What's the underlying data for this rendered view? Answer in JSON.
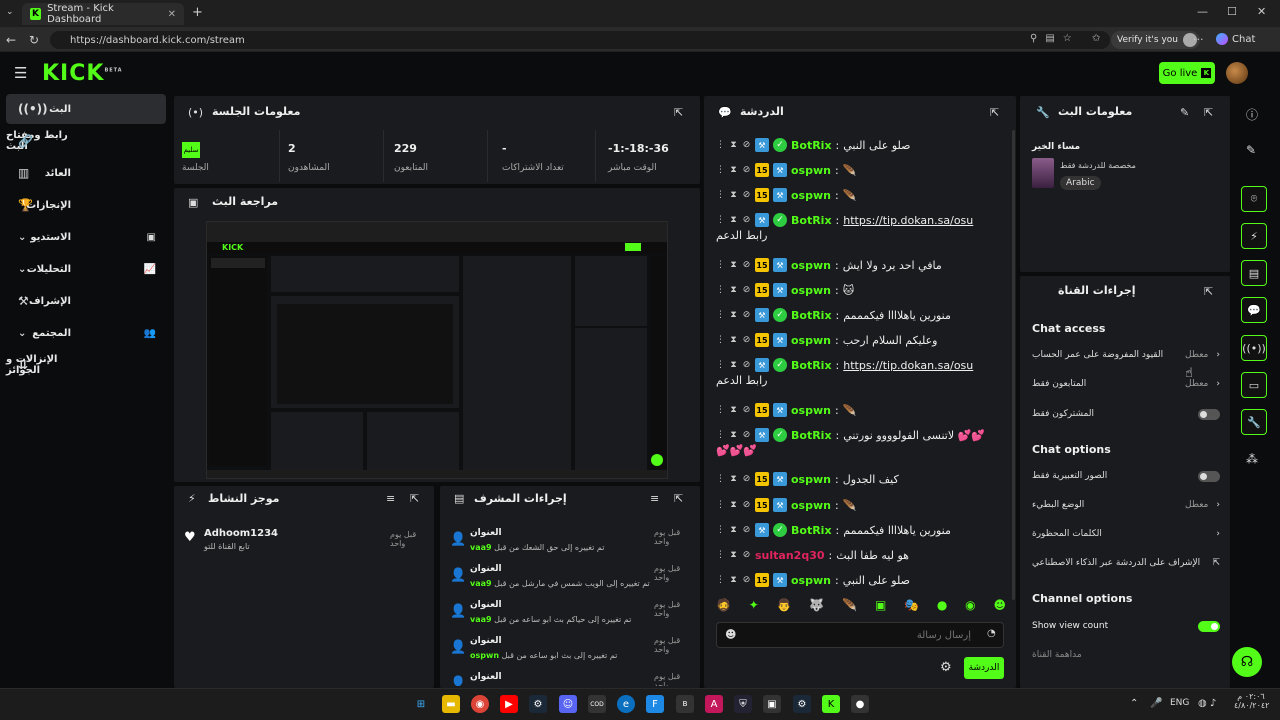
{
  "browser": {
    "tab_title": "Stream - Kick Dashboard",
    "url": "https://dashboard.kick.com/stream",
    "verify_label": "Verify it's you",
    "chat_label": "Chat"
  },
  "header": {
    "logo": "KICK",
    "logo_sup": "BETA",
    "go_live": "Go live"
  },
  "sidebar": {
    "items": [
      {
        "label": "البث"
      },
      {
        "label": "رابط ومفتاح البث"
      },
      {
        "label": "العائد"
      },
      {
        "label": "الإنجازات"
      },
      {
        "label": "الاستديو"
      },
      {
        "label": "التحليلات"
      },
      {
        "label": "الإشراف"
      },
      {
        "label": "المجتمع"
      },
      {
        "label": "الإنزالات و الجوائز"
      }
    ]
  },
  "session": {
    "title": "معلومات الجلسة",
    "badge": "سليم",
    "badge_caption": "الجلسة",
    "stats": [
      {
        "value": "2",
        "label": "المشاهدون"
      },
      {
        "value": "229",
        "label": "المتابعون"
      },
      {
        "value": "-",
        "label": "تعداد الاشتراكات"
      },
      {
        "value": "-1:-18:-36",
        "label": "الوقت مباشر"
      }
    ]
  },
  "preview": {
    "title": "مراجعة البث"
  },
  "activity": {
    "title": "موجز النشاط",
    "items": [
      {
        "user": "Adhoom1234",
        "desc": "تابع القناة للتو",
        "time": "قبل يوم واحد"
      }
    ]
  },
  "mod_actions": {
    "title": "إجراءات المشرف",
    "items": [
      {
        "title": "العنوان",
        "time": "قبل يوم واحد",
        "user": "vaa9",
        "desc": "تم تغييره إلى حق الشعك من قبل"
      },
      {
        "title": "العنوان",
        "time": "قبل يوم واحد",
        "user": "vaa9",
        "desc": "تم تغييره إلى الويب شمس في مارشل من قبل"
      },
      {
        "title": "العنوان",
        "time": "قبل يوم واحد",
        "user": "vaa9",
        "desc": "تم تغييره إلى حياكم بث ابو ساعه من قبل"
      },
      {
        "title": "العنوان",
        "time": "قبل يوم واحد",
        "user": "ospwn",
        "desc": "تم تغييره إلى بث ابو ساعه من قبل"
      },
      {
        "title": "العنوان",
        "time": "قبل يوم واحد",
        "user": "",
        "desc": ""
      }
    ]
  },
  "chat": {
    "title": "الدردشة",
    "placeholder": "إرسال رسالة",
    "send_label": "الدردشة",
    "messages": [
      {
        "user": "BotRix",
        "color": "#53fc18",
        "sub": "",
        "bot": true,
        "text": "صلو على النبي"
      },
      {
        "user": "ospwn",
        "color": "#53fc18",
        "sub": "15",
        "bot": false,
        "text": "🪶"
      },
      {
        "user": "ospwn",
        "color": "#53fc18",
        "sub": "15",
        "bot": false,
        "text": "🪶"
      },
      {
        "user": "BotRix",
        "color": "#53fc18",
        "sub": "",
        "bot": true,
        "text": "https://tip.dokan.sa/osu",
        "cont": "رابط الدعم"
      },
      {
        "user": "ospwn",
        "color": "#53fc18",
        "sub": "15",
        "bot": false,
        "text": "مافي احد يرد ولا ايش"
      },
      {
        "user": "ospwn",
        "color": "#53fc18",
        "sub": "15",
        "bot": false,
        "text": "🐱"
      },
      {
        "user": "BotRix",
        "color": "#53fc18",
        "sub": "",
        "bot": true,
        "text": "منورين ياهلاااا فيكمممم"
      },
      {
        "user": "ospwn",
        "color": "#53fc18",
        "sub": "15",
        "bot": false,
        "text": "وعليكم السلام ارحب"
      },
      {
        "user": "BotRix",
        "color": "#53fc18",
        "sub": "",
        "bot": true,
        "text": "https://tip.dokan.sa/osu",
        "cont": "رابط الدعم"
      },
      {
        "user": "ospwn",
        "color": "#53fc18",
        "sub": "15",
        "bot": false,
        "text": "🪶"
      },
      {
        "user": "BotRix",
        "color": "#53fc18",
        "sub": "",
        "bot": true,
        "text": "لاتنسى الفولوووو نورتني 💕💕",
        "cont": "💕💕💕"
      },
      {
        "user": "ospwn",
        "color": "#53fc18",
        "sub": "15",
        "bot": false,
        "text": "كيف الجدول"
      },
      {
        "user": "ospwn",
        "color": "#53fc18",
        "sub": "15",
        "bot": false,
        "text": "🪶"
      },
      {
        "user": "BotRix",
        "color": "#53fc18",
        "sub": "",
        "bot": true,
        "text": "منورين ياهلاااا فيكمممم"
      },
      {
        "user": "sultan2q30",
        "color": "#e0245e",
        "sub": "",
        "bot": false,
        "text": "هو ليه طفا البث"
      },
      {
        "user": "ospwn",
        "color": "#53fc18",
        "sub": "15",
        "bot": false,
        "text": "صلو على النبي"
      }
    ]
  },
  "stream_info": {
    "title": "معلومات البث",
    "stream_title": "مساء الخير",
    "category": "مخصصة للدردشة فقط",
    "language": "Arabic"
  },
  "channel_actions": {
    "title": "إجراءات القناة",
    "chat_access_header": "Chat access",
    "chat_access": [
      {
        "label": "القيود المفروضة على عمر الحساب",
        "state": "معطل",
        "kind": "chevron"
      },
      {
        "label": "المتابعون فقط",
        "state": "معطل",
        "kind": "chevron"
      },
      {
        "label": "المشتركون فقط",
        "state": "",
        "kind": "toggle-off"
      }
    ],
    "chat_options_header": "Chat options",
    "chat_options": [
      {
        "label": "الصور التعبيرية فقط",
        "state": "",
        "kind": "toggle-off"
      },
      {
        "label": "الوضع البطيء",
        "state": "معطل",
        "kind": "chevron"
      },
      {
        "label": "الكلمات المحظورة",
        "state": "",
        "kind": "chevron"
      },
      {
        "label": "الإشراف على الدردشة عبر الذكاء الاصطناعي",
        "state": "",
        "kind": "external"
      }
    ],
    "channel_options_header": "Channel options",
    "channel_options": [
      {
        "label": "Show view count",
        "kind": "toggle-on"
      },
      {
        "label": "مداهمة القناة",
        "kind": ""
      }
    ]
  },
  "taskbar": {
    "lang": "ENG",
    "time": "٠٢:٠٦ م",
    "date": "٤/٨٠/٢٠٤٢"
  },
  "colors": {
    "accent": "#53fc18",
    "panel": "#1a1b1e",
    "bg": "#0b0c0d"
  }
}
